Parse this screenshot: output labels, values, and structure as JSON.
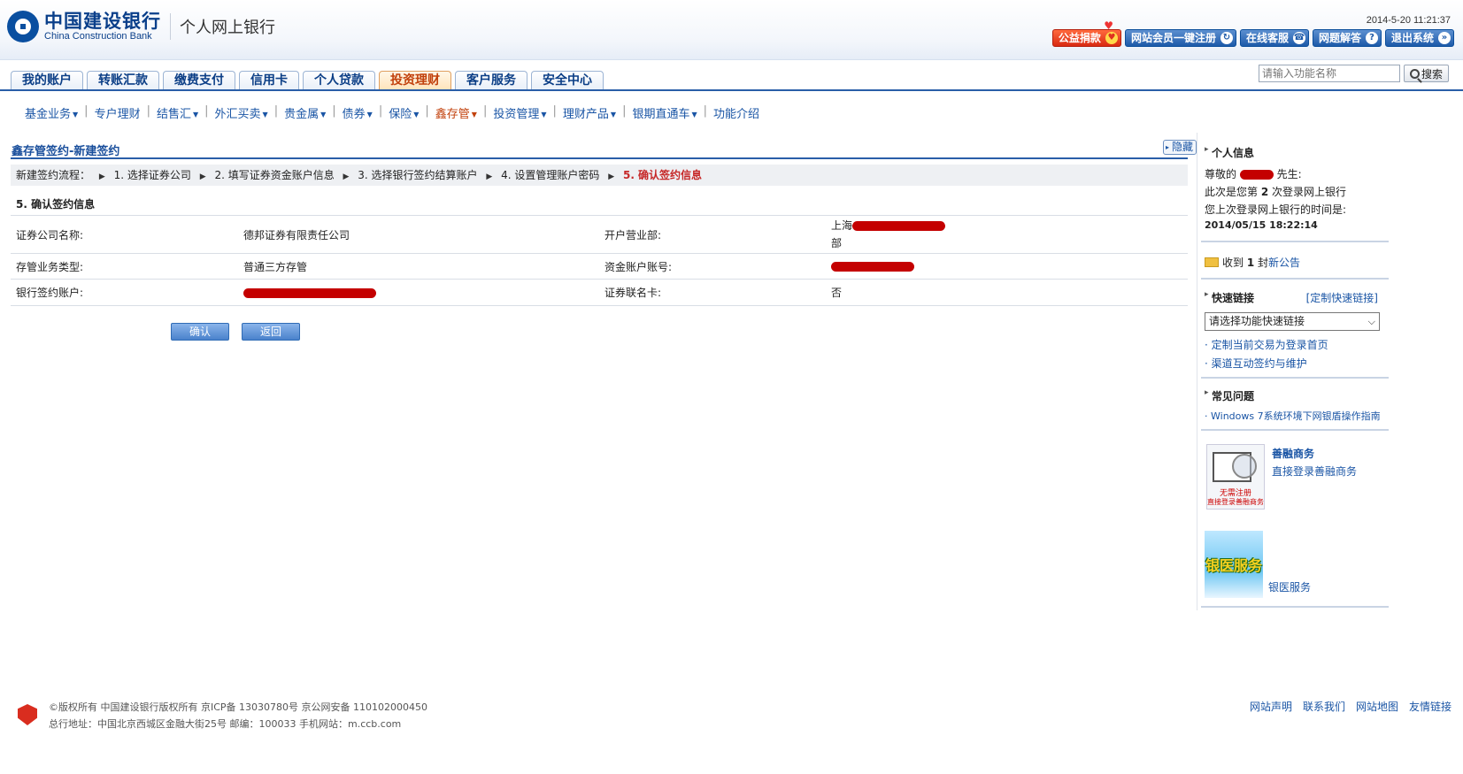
{
  "header": {
    "bank_cn": "中国建设银行",
    "bank_en": "China Construction Bank",
    "sub_title": "个人网上银行",
    "datetime": "2014-5-20 11:21:37",
    "top_links": [
      {
        "label": "公益捐款",
        "icon": "heart-icon"
      },
      {
        "label": "网站会员一键注册",
        "icon": "arrow-circle-icon"
      },
      {
        "label": "在线客服",
        "icon": "headset-icon"
      },
      {
        "label": "网题解答",
        "icon": "question-icon"
      },
      {
        "label": "退出系统",
        "icon": "exit-icon"
      }
    ],
    "search_placeholder": "请输入功能名称",
    "search_button": "搜索"
  },
  "tabs": [
    "我的账户",
    "转账汇款",
    "缴费支付",
    "信用卡",
    "个人贷款",
    "投资理财",
    "客户服务",
    "安全中心"
  ],
  "active_tab": "投资理财",
  "subnav": [
    "基金业务",
    "专户理财",
    "结售汇",
    "外汇买卖",
    "贵金属",
    "债券",
    "保险",
    "鑫存管",
    "投资管理",
    "理财产品",
    "银期直通车",
    "功能介绍"
  ],
  "subnav_with_caret": [
    true,
    false,
    true,
    true,
    true,
    true,
    true,
    true,
    true,
    true,
    true,
    false
  ],
  "active_subnav": "鑫存管",
  "main": {
    "title": "鑫存管签约-新建签约",
    "hide_label": "隐藏",
    "flow_label": "新建签约流程：",
    "flow_steps": [
      "1. 选择证券公司",
      "2. 填写证券资金账户信息",
      "3. 选择银行签约结算账户",
      "4. 设置管理账户密码",
      "5. 确认签约信息"
    ],
    "section_title": "5. 确认签约信息",
    "rows": [
      {
        "label1": "证券公司名称:",
        "value1": "德邦证券有限责任公司",
        "label2": "开户营业部:",
        "value2_prefix": "上海",
        "value2_suffix": "部"
      },
      {
        "label1": "存管业务类型:",
        "value1": "普通三方存管",
        "label2": "资金账户账号:",
        "value2": ""
      },
      {
        "label1": "银行签约账户:",
        "value1": "",
        "label2": "证券联名卡:",
        "value2": "否"
      }
    ],
    "confirm_label": "确认",
    "back_label": "返回"
  },
  "sidebar": {
    "personal_title": "个人信息",
    "greeting_prefix": "尊敬的",
    "greeting_suffix": "先生:",
    "login_prefix": "此次是您第",
    "login_count": "2",
    "login_suffix": "次登录网上银行",
    "last_login_label": "您上次登录网上银行的时间是:",
    "last_login_time": "2014/05/15 18:22:14",
    "notice_prefix": "收到",
    "notice_count": "1",
    "notice_unit": "封",
    "notice_link": "新公告",
    "quick_title": "快速链接",
    "quick_custom": "[定制快速链接]",
    "quick_select": "请选择功能快速链接",
    "quick_links": [
      "定制当前交易为登录首页",
      "渠道互动签约与维护"
    ],
    "faq_title": "常见问题",
    "faq_links": [
      "Windows 7系统环境下网银盾操作指南"
    ],
    "promo1_title": "善融商务",
    "promo1_desc": "直接登录善融商务",
    "promo1_caption1": "无需注册",
    "promo1_caption2": "直接登录善融商务",
    "promo2_img_text": "银医服务",
    "promo2_label": "银医服务"
  },
  "footer": {
    "line1": "©版权所有 中国建设银行版权所有 京ICP备 13030780号 京公网安备 110102000450",
    "line2": "总行地址：中国北京西城区金融大街25号 邮编：100033 手机网站：m.ccb.com",
    "links": [
      "网站声明",
      "联系我们",
      "网站地图",
      "友情链接"
    ]
  },
  "colors": {
    "brand_blue": "#0a4fa0",
    "active_orange": "#c2410c",
    "redact_red": "#c40000"
  }
}
